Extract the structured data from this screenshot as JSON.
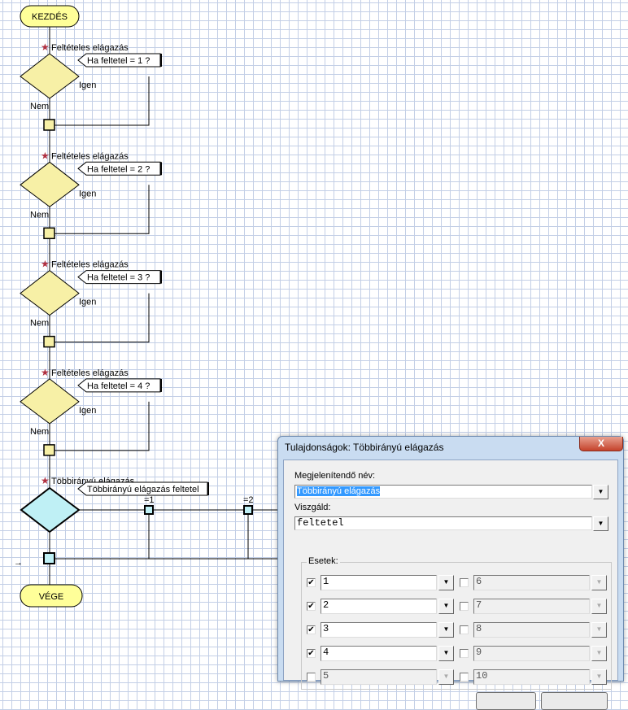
{
  "flowchart": {
    "start": "KEZDÉS",
    "end": "VÉGE",
    "conditions": [
      {
        "title": "Feltételes elágazás",
        "label": "Ha feltetel = 1 ?",
        "yes": "Igen",
        "no": "Nem"
      },
      {
        "title": "Feltételes elágazás",
        "label": "Ha feltetel = 2 ?",
        "yes": "Igen",
        "no": "Nem"
      },
      {
        "title": "Feltételes elágazás",
        "label": "Ha feltetel = 3 ?",
        "yes": "Igen",
        "no": "Nem"
      },
      {
        "title": "Feltételes elágazás",
        "label": "Ha feltetel = 4 ?",
        "yes": "Igen",
        "no": "Nem"
      }
    ],
    "switch": {
      "title": "Többirányú elágazás",
      "label": "Többirányú elágazás feltetel",
      "cases": [
        "=1",
        "=2"
      ]
    },
    "entry_arrow": "→",
    "colors": {
      "terminal": "#ffff99",
      "condition": "#f7f0a6",
      "switch": "#bff0f5"
    }
  },
  "dialog": {
    "title": "Tulajdonságok:  Többirányú elágazás",
    "close": "X",
    "name_label": "Megjelenítendő név:",
    "name_value": "Többirányú elágazás",
    "test_label": "Viszgáld:",
    "test_value": "feltetel",
    "cases_label": "Esetek:",
    "cases": [
      {
        "value": "1",
        "checked": true
      },
      {
        "value": "2",
        "checked": true
      },
      {
        "value": "3",
        "checked": true
      },
      {
        "value": "4",
        "checked": true
      },
      {
        "value": "5",
        "checked": false
      },
      {
        "value": "6",
        "checked": false
      },
      {
        "value": "7",
        "checked": false
      },
      {
        "value": "8",
        "checked": false
      },
      {
        "value": "9",
        "checked": false
      },
      {
        "value": "10",
        "checked": false
      }
    ],
    "dropdown_icon": "▼",
    "check_mark": "✔"
  }
}
